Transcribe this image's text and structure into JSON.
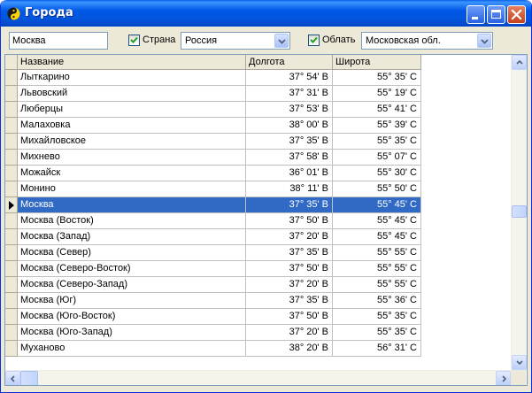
{
  "window": {
    "title": "Города"
  },
  "filters": {
    "search_value": "Москва",
    "country_checkbox": {
      "label": "Страна",
      "checked": true
    },
    "country_value": "Россия",
    "region_checkbox": {
      "label": "Облать",
      "checked": true
    },
    "region_value": "Московская обл."
  },
  "table": {
    "columns": [
      "Название",
      "Долгота",
      "Широта"
    ],
    "rows": [
      {
        "name": "Лыткарино",
        "longitude": "37° 54' В",
        "latitude": "55° 35' С"
      },
      {
        "name": "Львовский",
        "longitude": "37° 31' В",
        "latitude": "55° 19' С"
      },
      {
        "name": "Люберцы",
        "longitude": "37° 53' В",
        "latitude": "55° 41' С"
      },
      {
        "name": "Малаховка",
        "longitude": "38° 00' В",
        "latitude": "55° 39' С"
      },
      {
        "name": "Михайловское",
        "longitude": "37° 35' В",
        "latitude": "55° 35' С"
      },
      {
        "name": "Михнево",
        "longitude": "37° 58' В",
        "latitude": "55° 07' С"
      },
      {
        "name": "Можайск",
        "longitude": "36° 01' В",
        "latitude": "55° 30' С"
      },
      {
        "name": "Монино",
        "longitude": "38° 11' В",
        "latitude": "55° 50' С"
      },
      {
        "name": "Москва",
        "longitude": "37° 35' В",
        "latitude": "55° 45' С",
        "selected": true
      },
      {
        "name": "Москва (Восток)",
        "longitude": "37° 50' В",
        "latitude": "55° 45' С"
      },
      {
        "name": "Москва (Запад)",
        "longitude": "37° 20' В",
        "latitude": "55° 45' С"
      },
      {
        "name": "Москва (Север)",
        "longitude": "37° 35' В",
        "latitude": "55° 55' С"
      },
      {
        "name": "Москва (Северо-Восток)",
        "longitude": "37° 50' В",
        "latitude": "55° 55' С"
      },
      {
        "name": "Москва (Северо-Запад)",
        "longitude": "37° 20' В",
        "latitude": "55° 55' С"
      },
      {
        "name": "Москва (Юг)",
        "longitude": "37° 35' В",
        "latitude": "55° 36' С"
      },
      {
        "name": "Москва (Юго-Восток)",
        "longitude": "37° 50' В",
        "latitude": "55° 35' С"
      },
      {
        "name": "Москва (Юго-Запад)",
        "longitude": "37° 20' В",
        "latitude": "55° 35' С"
      },
      {
        "name": "Муханово",
        "longitude": "38° 20' В",
        "latitude": "56° 31' С"
      }
    ]
  },
  "colors": {
    "selection": "#316ac5",
    "titlebar": "#0058e6"
  },
  "icons": {
    "app": "yin-yang-icon",
    "minimize": "minimize-icon",
    "maximize": "maximize-icon",
    "close": "close-icon",
    "dropdown": "chevron-down-icon",
    "row_pointer": "row-pointer-icon"
  }
}
